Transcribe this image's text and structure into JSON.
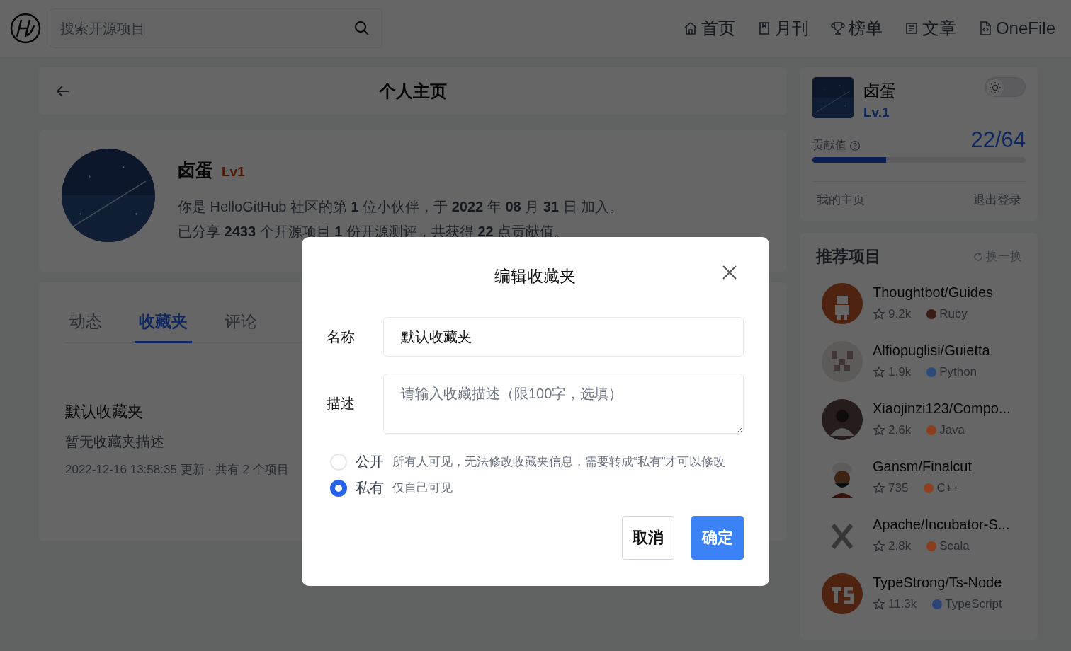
{
  "header": {
    "search": {
      "placeholder": "搜索开源项目"
    },
    "nav": [
      {
        "kind": "home",
        "label": "首页"
      },
      {
        "kind": "book",
        "label": "月刊"
      },
      {
        "kind": "trophy",
        "label": "榜单"
      },
      {
        "kind": "doc",
        "label": "文章"
      },
      {
        "kind": "file",
        "label": "OneFile"
      }
    ]
  },
  "page_bar": {
    "title": "个人主页"
  },
  "profile": {
    "name": "卤蛋",
    "level": "Lv1",
    "lines": [
      "你是 HelloGitHub 社区的第 **1** 位小伙伴，于 **2022** 年 **08** 月 **31** 日 加入。",
      "已分享 **2433** 个开源项目 **1** 份开源测评，共获得 **22** 点贡献值。"
    ]
  },
  "tabs": [
    {
      "label": "动态",
      "selected": false
    },
    {
      "label": "收藏夹",
      "selected": true
    },
    {
      "label": "评论",
      "selected": false
    }
  ],
  "collection": {
    "title": "默认收藏夹",
    "description": "暂无收藏夹描述",
    "meta": "2022-12-16 13:58:35 更新 · 共有 2 个项目"
  },
  "user_card": {
    "name": "卤蛋",
    "level": "Lv.1",
    "theme_toggle": {
      "on": false
    },
    "contribution_label": "贡献值",
    "contribution": "22/64",
    "level_bar": {
      "level": 0.344
    },
    "links": [
      "我的主页",
      "退出登录"
    ]
  },
  "recommended": {
    "title": "推荐项目",
    "refresh": "换一换",
    "items": [
      {
        "name": "Thoughtbot/Guides",
        "stars": "9.2k",
        "language": "Ruby",
        "color": "#3a1c14"
      },
      {
        "name": "Alfiopuglisi/Guietta",
        "stars": "1.9k",
        "language": "Python",
        "color": "#2c4a7c"
      },
      {
        "name": "Xiaojinzi123/Compo...",
        "stars": "2.6k",
        "language": "Java",
        "color": "#8a3e1e"
      },
      {
        "name": "Gansm/Finalcut",
        "stars": "735",
        "language": "C++",
        "color": "#8c401f"
      },
      {
        "name": "Apache/Incubator-S...",
        "stars": "2.8k",
        "language": "Scala",
        "color": "#8a3c1e"
      },
      {
        "name": "TypeStrong/Ts-Node",
        "stars": "11.3k",
        "language": "TypeScript",
        "color": "#2a4478"
      }
    ]
  },
  "dialog": {
    "title": "编辑收藏夹",
    "name_label": "名称",
    "name_value": "默认收藏夹",
    "desc_label": "描述",
    "desc_placeholder": "请输入收藏描述（限100字，选填）",
    "options": [
      {
        "label": "公开",
        "hint": "所有人可见，无法修改收藏夹信息，需要转成“私有”才可以修改",
        "selected": false
      },
      {
        "label": "私有",
        "hint": "仅自己可见",
        "selected": true
      }
    ],
    "buttons": [
      {
        "kind": "cancel",
        "label": "取消"
      },
      {
        "kind": "confirm",
        "label": "确定"
      }
    ]
  }
}
